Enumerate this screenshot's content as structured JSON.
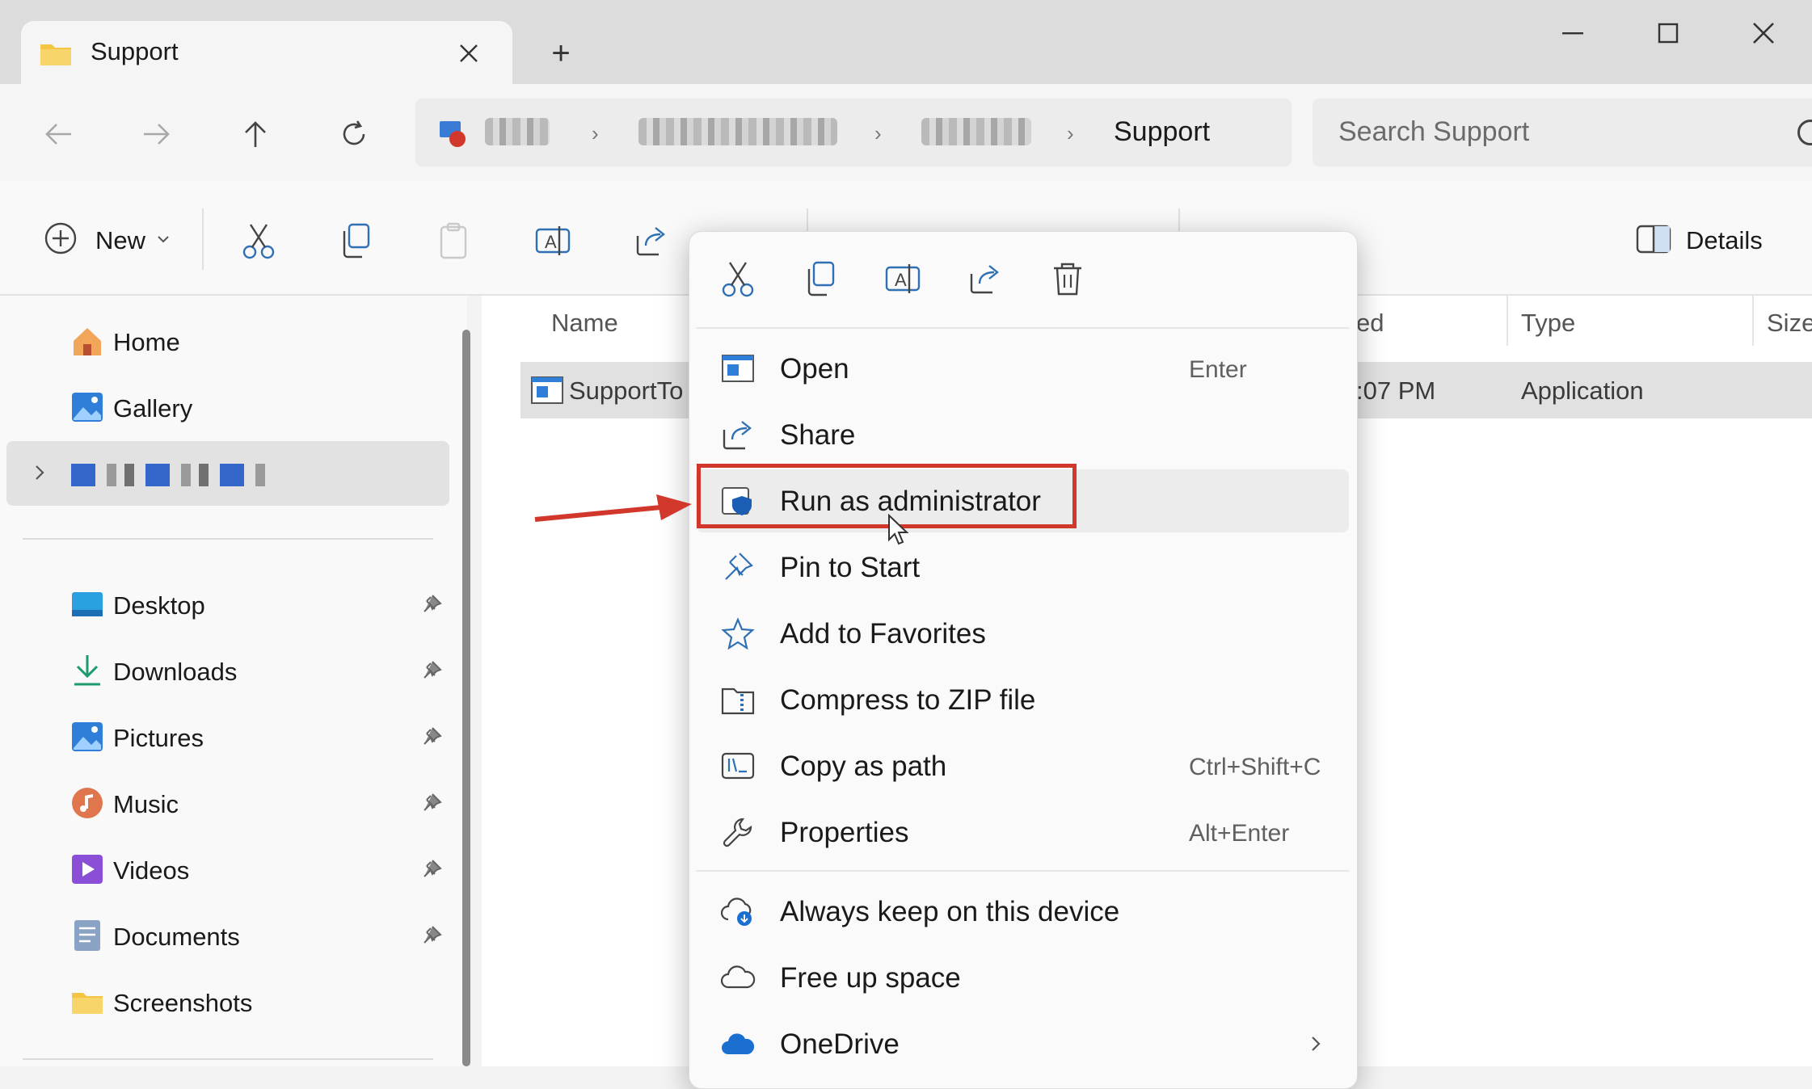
{
  "window": {
    "tab_title": "Support",
    "new_tab": "+",
    "controls": {
      "minimize": "minimize",
      "maximize": "maximize",
      "close": "close"
    }
  },
  "address": {
    "crumbs": [
      "Support"
    ],
    "search_placeholder": "Search Support"
  },
  "toolbar": {
    "new_label": "New",
    "details_label": "Details"
  },
  "nav": {
    "top": [
      {
        "label": "Home"
      },
      {
        "label": "Gallery"
      }
    ],
    "pinned": [
      {
        "label": "Desktop"
      },
      {
        "label": "Downloads"
      },
      {
        "label": "Pictures"
      },
      {
        "label": "Music"
      },
      {
        "label": "Videos"
      },
      {
        "label": "Documents"
      },
      {
        "label": "Screenshots"
      }
    ]
  },
  "list": {
    "columns": {
      "name": "Name",
      "modified": "ed",
      "type": "Type",
      "size": "Size"
    },
    "row": {
      "name": "SupportTo",
      "modified": ":07 PM",
      "type": "Application"
    }
  },
  "context_menu": {
    "items": [
      {
        "label": "Open",
        "shortcut": "Enter"
      },
      {
        "label": "Share",
        "shortcut": ""
      },
      {
        "label": "Run as administrator",
        "shortcut": ""
      },
      {
        "label": "Pin to Start",
        "shortcut": ""
      },
      {
        "label": "Add to Favorites",
        "shortcut": ""
      },
      {
        "label": "Compress to ZIP file",
        "shortcut": ""
      },
      {
        "label": "Copy as path",
        "shortcut": "Ctrl+Shift+C"
      },
      {
        "label": "Properties",
        "shortcut": "Alt+Enter"
      }
    ],
    "cloud_items": [
      {
        "label": "Always keep on this device"
      },
      {
        "label": "Free up space"
      },
      {
        "label": "OneDrive"
      }
    ]
  },
  "colors": {
    "highlight": "#d2372b",
    "accent": "#0067c0",
    "folder": "#f4c542"
  }
}
